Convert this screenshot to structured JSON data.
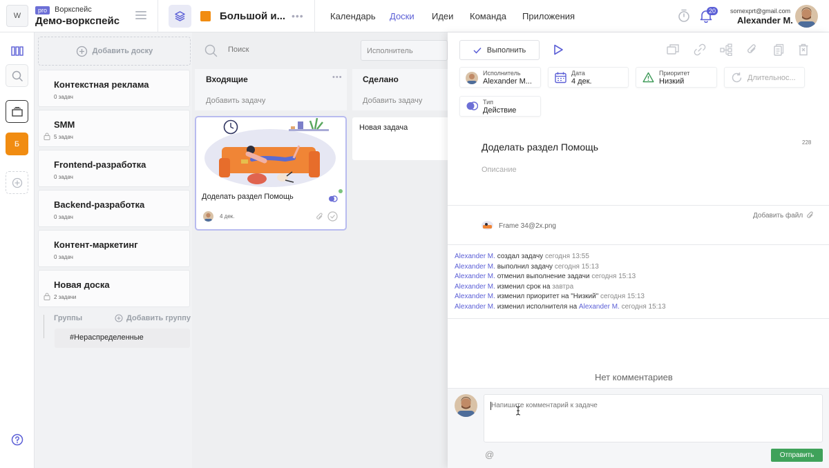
{
  "workspace": {
    "logo_letter": "W",
    "plan": "pro",
    "type_label": "Воркспейс",
    "name": "Демо-воркспейс"
  },
  "board": {
    "title": "Большой и...",
    "color": "#f18c11"
  },
  "nav": {
    "items": [
      "Календарь",
      "Доски",
      "Идеи",
      "Команда",
      "Приложения"
    ],
    "active": "Доски"
  },
  "notifications": {
    "count": "20"
  },
  "user": {
    "email": "somexprt@gmail.com",
    "name": "Alexander M."
  },
  "rail": {
    "workspace_letter": "Б"
  },
  "boards": {
    "add_label": "Добавить доску",
    "items": [
      {
        "title": "Контекстная реклама",
        "count": "0 задач",
        "locked": false
      },
      {
        "title": "SMM",
        "count": "5 задач",
        "locked": true
      },
      {
        "title": "Frontend-разработка",
        "count": "0 задач",
        "locked": false
      },
      {
        "title": "Backend-разработка",
        "count": "0 задач",
        "locked": false
      },
      {
        "title": "Контент-маркетинг",
        "count": "0 задач",
        "locked": false
      },
      {
        "title": "Новая доска",
        "count": "2 задачи",
        "locked": true
      }
    ],
    "groups_label": "Группы",
    "add_group_label": "Добавить группу",
    "group_item": "#Нераспределенные"
  },
  "kanban": {
    "search_placeholder": "Поиск",
    "assignee_placeholder": "Исполнитель",
    "columns": [
      {
        "title": "Входящие",
        "add_label": "Добавить задачу"
      },
      {
        "title": "Сделано",
        "add_label": "Добавить задачу"
      }
    ],
    "card": {
      "title": "Доделать раздел Помощь",
      "date": "4 дек."
    },
    "new_task": "Новая задача"
  },
  "task": {
    "complete_label": "Выполнить",
    "meta": {
      "assignee_label": "Исполнитель",
      "assignee_value": "Alexander M...",
      "date_label": "Дата",
      "date_value": "4 дек.",
      "priority_label": "Приоритет",
      "priority_value": "Низкий",
      "duration_label": "Длительнос...",
      "type_label": "Тип",
      "type_value": "Действие"
    },
    "title": "Доделать раздел Помощь",
    "char_count": "228",
    "description_placeholder": "Описание",
    "add_file_label": "Добавить файл",
    "attachment": "Frame 34@2x.png"
  },
  "activity": [
    {
      "user": "Alexander M.",
      "action": "создал задачу",
      "time": "сегодня 13:55"
    },
    {
      "user": "Alexander M.",
      "action": "выполнил задачу",
      "time": "сегодня 15:13"
    },
    {
      "user": "Alexander M.",
      "action": "отменил выполнение задачи",
      "time": "сегодня 15:13"
    },
    {
      "user": "Alexander M.",
      "action": "изменил срок на",
      "time": "завтра"
    },
    {
      "user": "Alexander M.",
      "action": "изменил приоритет на \"Низкий\"",
      "time": "сегодня 15:13"
    },
    {
      "user": "Alexander M.",
      "action": "изменил исполнителя на",
      "extra_user": "Alexander M.",
      "time": "сегодня 15:13"
    }
  ],
  "comments": {
    "empty_label": "Нет комментариев",
    "placeholder": "Напишите комментарий к задаче",
    "mention_symbol": "@",
    "send_label": "Отправить"
  },
  "colors": {
    "accent": "#5b5fd6",
    "send": "#3fa25a",
    "board_orange": "#f18c11"
  }
}
